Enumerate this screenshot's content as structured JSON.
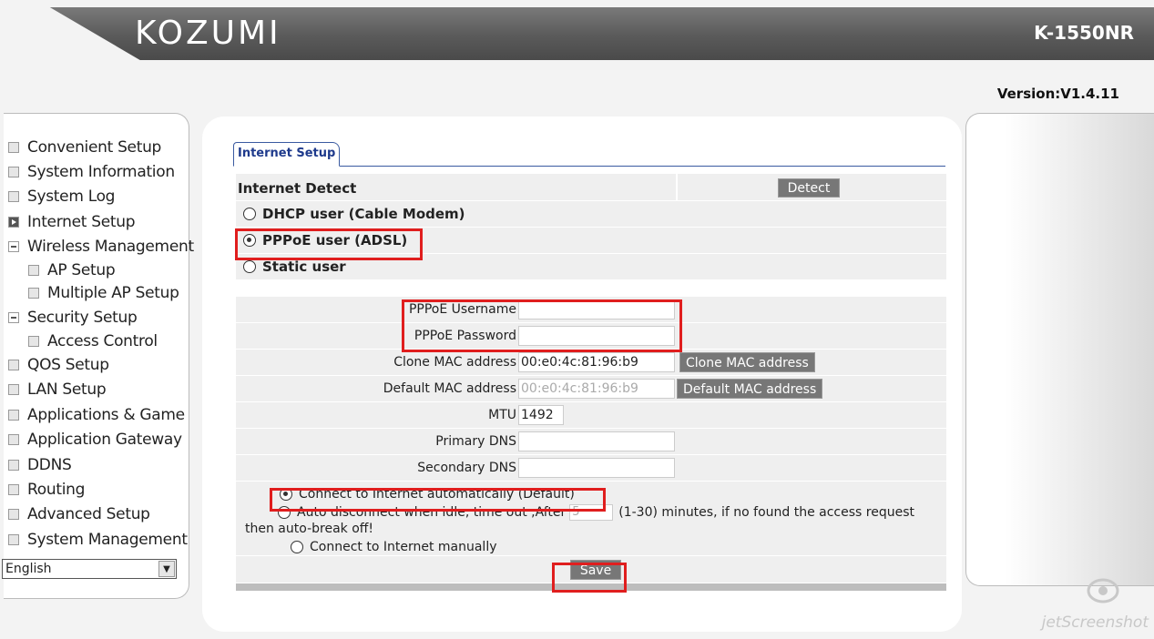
{
  "header": {
    "brand": "KOZUMI",
    "model": "K-1550NR",
    "version": "Version:V1.4.11"
  },
  "sidebar": {
    "items": [
      {
        "label": "Convenient Setup",
        "icon": "square-icon"
      },
      {
        "label": "System Information",
        "icon": "square-icon"
      },
      {
        "label": "System Log",
        "icon": "square-icon"
      },
      {
        "label": "Internet Setup",
        "icon": "arrow-icon"
      },
      {
        "label": "Wireless Management",
        "icon": "collapse-icon"
      },
      {
        "label": "AP Setup",
        "icon": "square-icon",
        "sub": true
      },
      {
        "label": "Multiple AP Setup",
        "icon": "square-icon",
        "sub": true
      },
      {
        "label": "Security Setup",
        "icon": "collapse-icon"
      },
      {
        "label": "Access Control",
        "icon": "square-icon",
        "sub": true
      },
      {
        "label": "QOS Setup",
        "icon": "square-icon"
      },
      {
        "label": "LAN Setup",
        "icon": "square-icon"
      },
      {
        "label": "Applications & Game",
        "icon": "square-icon"
      },
      {
        "label": "Application Gateway",
        "icon": "square-icon"
      },
      {
        "label": "DDNS",
        "icon": "square-icon"
      },
      {
        "label": "Routing",
        "icon": "square-icon"
      },
      {
        "label": "Advanced Setup",
        "icon": "square-icon"
      },
      {
        "label": "System Management",
        "icon": "square-icon"
      }
    ],
    "language": "English"
  },
  "main": {
    "tab": "Internet Setup",
    "detect_label": "Internet Detect",
    "detect_button": "Detect",
    "modes": [
      {
        "label": "DHCP user (Cable Modem)",
        "selected": false
      },
      {
        "label": "PPPoE user (ADSL)",
        "selected": true
      },
      {
        "label": "Static user",
        "selected": false
      }
    ],
    "fields": {
      "username_label": "PPPoE Username",
      "username_value": "",
      "password_label": "PPPoE Password",
      "password_value": "",
      "clone_mac_label": "Clone MAC address",
      "clone_mac_value": "00:e0:4c:81:96:b9",
      "clone_mac_button": "Clone MAC address",
      "default_mac_label": "Default MAC address",
      "default_mac_value": "00:e0:4c:81:96:b9",
      "default_mac_button": "Default MAC address",
      "mtu_label": "MTU",
      "mtu_value": "1492",
      "primary_dns_label": "Primary DNS",
      "primary_dns_value": "",
      "secondary_dns_label": "Secondary DNS",
      "secondary_dns_value": ""
    },
    "connection": {
      "auto_label": "Connect to Internet automatically (Default)",
      "auto_selected": true,
      "idle_prefix": "Auto disconnect when idle, time out ,After",
      "idle_value": "5",
      "idle_suffix": "(1-30) minutes, if no found the access request",
      "idle_suffix2": "then auto-break off!",
      "manual_label": "Connect to Internet manually"
    },
    "save_button": "Save"
  },
  "watermark": "jetScreenshot",
  "colors": {
    "annotation": "#e01e1e",
    "button": "#777777",
    "tab_accent": "#1e3a8c"
  }
}
